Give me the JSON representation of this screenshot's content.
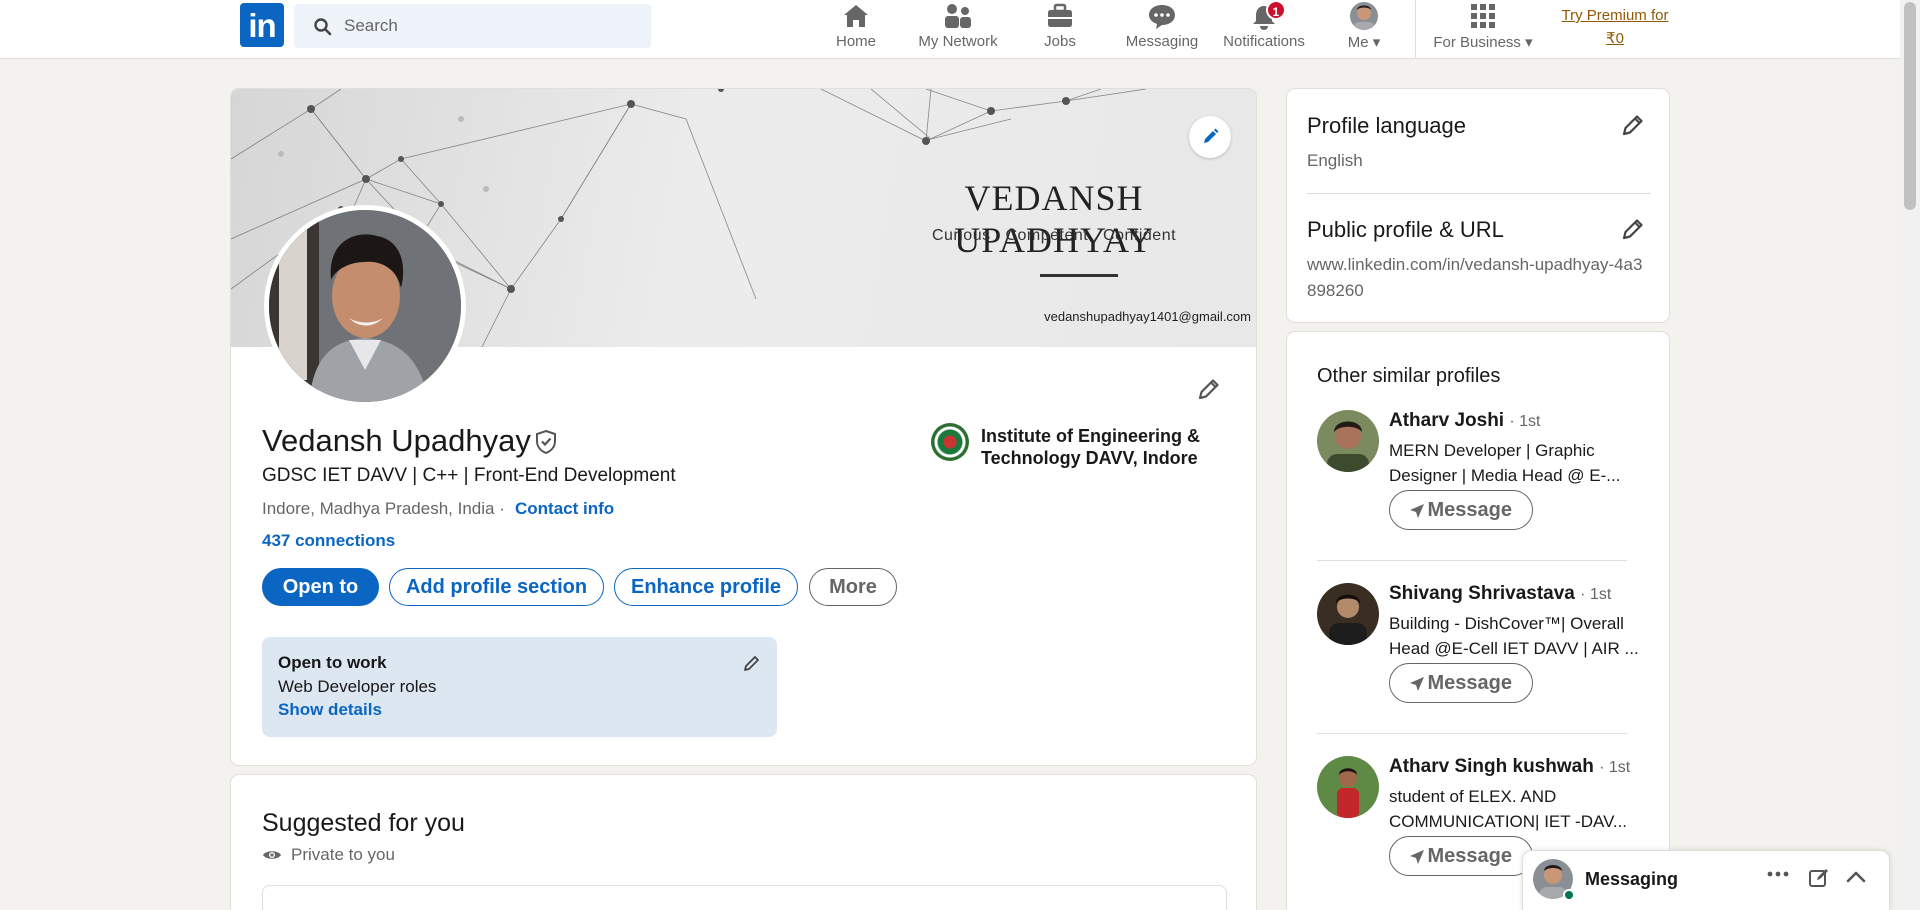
{
  "nav": {
    "logo_text": "in",
    "search_placeholder": "Search",
    "items": [
      {
        "label": "Home",
        "icon": "home-icon"
      },
      {
        "label": "My Network",
        "icon": "network-icon"
      },
      {
        "label": "Jobs",
        "icon": "briefcase-icon"
      },
      {
        "label": "Messaging",
        "icon": "chat-icon"
      },
      {
        "label": "Notifications",
        "icon": "bell-icon",
        "badge": "1"
      },
      {
        "label": "Me",
        "icon": "avatar"
      },
      {
        "label": "For Business",
        "icon": "grid-icon"
      }
    ],
    "premium": "Try Premium for ₹0"
  },
  "profile": {
    "banner": {
      "name": "VEDANSH UPADHYAY",
      "tagline": "Curious .  Competent . Confident",
      "email": "vedanshupadhyay1401@gmail.com"
    },
    "name": "Vedansh Upadhyay",
    "headline": "GDSC IET DAVV | C++ | Front-End Development",
    "location": "Indore, Madhya Pradesh, India ·",
    "contact": "Contact info",
    "connections": "437 connections",
    "education": "Institute of Engineering & Technology DAVV, Indore",
    "buttons": {
      "open_to": "Open to",
      "add_section": "Add profile section",
      "enhance": "Enhance profile",
      "more": "More"
    },
    "open_to_work": {
      "title": "Open to work",
      "roles": "Web Developer roles",
      "details": "Show details"
    }
  },
  "suggested": {
    "title": "Suggested for you",
    "private": "Private to you"
  },
  "sidebar": {
    "language": {
      "title": "Profile language",
      "value": "English"
    },
    "public_url": {
      "title": "Public profile & URL",
      "value": "www.linkedin.com/in/vedansh-upadhyay-4a3898260"
    },
    "similar": {
      "title": "Other similar profiles",
      "message_label": "Message",
      "profiles": [
        {
          "name": "Atharv Joshi",
          "degree": "· 1st",
          "headline": "MERN Developer | Graphic Designer | Media Head @ E-..."
        },
        {
          "name": "Shivang Shrivastava",
          "degree": "· 1st",
          "headline": "Building - DishCover™| Overall Head @E-Cell IET DAVV | AIR ..."
        },
        {
          "name": "Atharv Singh kushwah",
          "degree": "· 1st",
          "headline": "student of ELEX. AND COMMUNICATION| IET -DAV..."
        }
      ]
    }
  },
  "messaging": {
    "label": "Messaging"
  },
  "colors": {
    "brand": "#0a66c2",
    "premium": "#915907",
    "badge": "#cb112d",
    "background": "#f4f2ee"
  }
}
